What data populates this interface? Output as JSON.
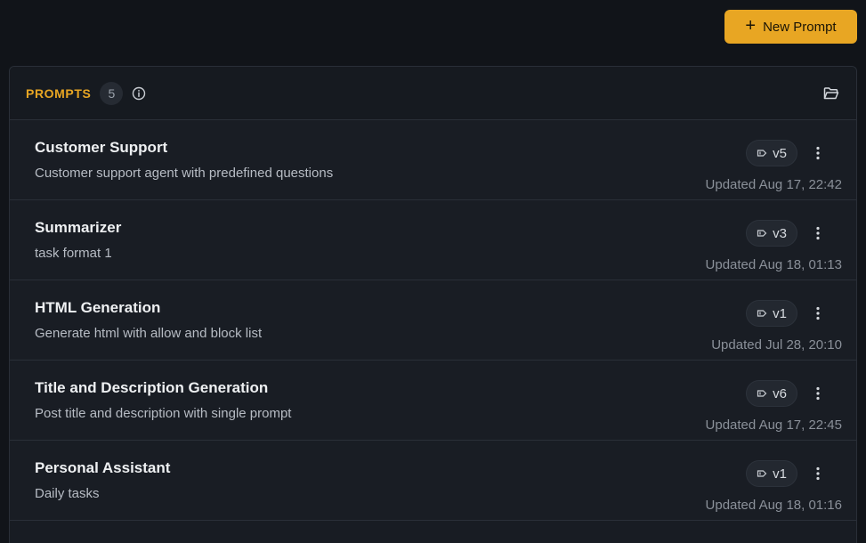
{
  "toolbar": {
    "new_prompt_label": "New Prompt",
    "new_prompt_icon": "plus-icon",
    "accent": "#e8a623"
  },
  "panel": {
    "title": "PROMPTS",
    "count": "5",
    "info_icon": "info-icon",
    "folder_icon": "folder-open-icon"
  },
  "prompts": [
    {
      "title": "Customer Support",
      "description": "Customer support agent with predefined questions",
      "version": "v5",
      "updated": "Updated Aug 17, 22:42"
    },
    {
      "title": "Summarizer",
      "description": "task format 1",
      "version": "v3",
      "updated": "Updated Aug 18, 01:13"
    },
    {
      "title": "HTML Generation",
      "description": "Generate html with allow and block list",
      "version": "v1",
      "updated": "Updated Jul 28, 20:10"
    },
    {
      "title": "Title and Description Generation",
      "description": "Post title and description with single prompt",
      "version": "v6",
      "updated": "Updated Aug 17, 22:45"
    },
    {
      "title": "Personal Assistant",
      "description": "Daily tasks",
      "version": "v1",
      "updated": "Updated Aug 18, 01:16"
    }
  ]
}
